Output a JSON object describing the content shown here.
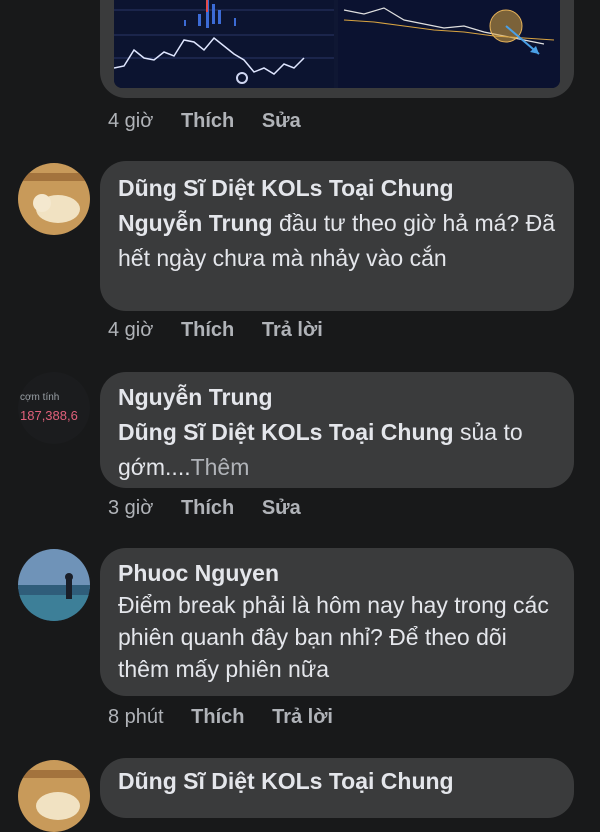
{
  "image_post": {
    "time": "4 giờ",
    "like": "Thích",
    "edit": "Sửa"
  },
  "comments": [
    {
      "author": "Dũng Sĩ Diệt KOLs Toại Chung",
      "mention": "Nguyễn Trung",
      "text": " đầu tư theo giờ hả má? Đã hết ngày chưa mà nhảy vào cắn",
      "time": "4 giờ",
      "like": "Thích",
      "action": "Trả lời"
    },
    {
      "author": "Nguyễn Trung",
      "avatar_text": [
        "cợm tính",
        "187,388,6"
      ],
      "mention": "Dũng Sĩ Diệt KOLs Toại Chung",
      "text": " sủa to gớm....",
      "more": "Thêm",
      "time": "3 giờ",
      "like": "Thích",
      "action": "Sửa"
    },
    {
      "author": "Phuoc Nguyen",
      "text": "Điểm break phải là hôm nay hay trong các phiên quanh đây bạn nhỉ? Để theo dõi thêm mấy phiên nữa",
      "time": "8 phút",
      "like": "Thích",
      "action": "Trả lời"
    },
    {
      "author": "Dũng Sĩ Diệt KOLs Toại Chung"
    }
  ],
  "colors": {
    "background": "#18191a",
    "bubble": "#3a3b3c",
    "text": "#e4e6eb",
    "muted": "#b0b3b8",
    "chart_bg": "#0f1733"
  }
}
